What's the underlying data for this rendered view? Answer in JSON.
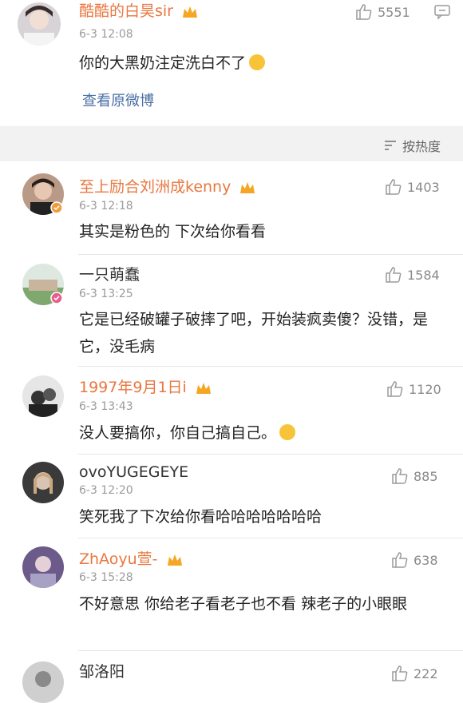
{
  "header_comment": {
    "username": "酷酷的白昊sir",
    "time": "6-3 12:08",
    "likes": "5551",
    "text": "你的大黑奶注定洗白不了",
    "link": "查看原微博"
  },
  "sort": {
    "label": "按热度"
  },
  "comments": [
    {
      "username": "至上励合刘洲成kenny",
      "time": "6-3 12:18",
      "likes": "1403",
      "text": "其实是粉色的 下次给你看看"
    },
    {
      "username": "一只萌蠢",
      "time": "6-3 13:25",
      "likes": "1584",
      "text": "它是已经破罐子破摔了吧，开始装疯卖傻？没错，是它，没毛病"
    },
    {
      "username": "1997年9月1日i",
      "time": "6-3 13:43",
      "likes": "1120",
      "text": "没人要搞你，你自己搞自己。"
    },
    {
      "username": "ovoYUGEGEYE",
      "time": "6-3 12:20",
      "likes": "885",
      "text": "笑死我了下次给你看哈哈哈哈哈哈哈"
    },
    {
      "username": "ZhAoyu萱-",
      "time": "6-3 15:28",
      "likes": "638",
      "text": "不好意思 你给老子看老子也不看  辣老子的小眼眼"
    },
    {
      "username": "邹洛阳",
      "likes": "222"
    }
  ],
  "colors": {
    "username_orange": "#e9773f",
    "link_blue": "#4a6fa5"
  }
}
